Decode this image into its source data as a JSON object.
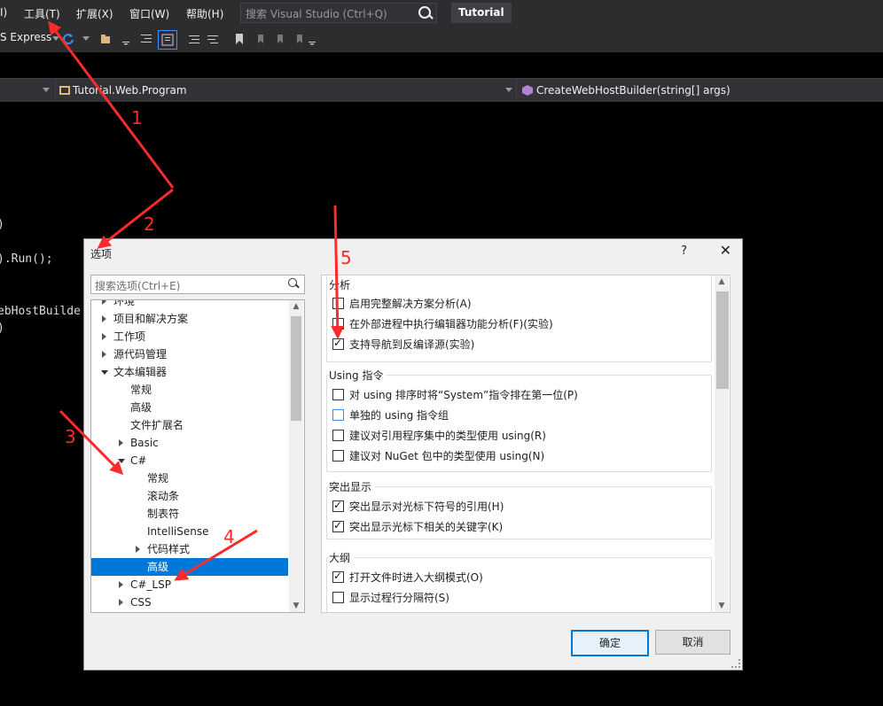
{
  "menu": {
    "items": [
      "I)",
      "工具(T)",
      "扩展(X)",
      "窗口(W)",
      "帮助(H)"
    ],
    "search_placeholder": "搜索 Visual Studio (Ctrl+Q)",
    "title": "Tutorial"
  },
  "toolbar": {
    "config_label": "S Express"
  },
  "navbar": {
    "class_label": "Tutorial.Web.Program",
    "member_label": "CreateWebHostBuilder(string[] args)"
  },
  "editor": {
    "lines": [
      ")",
      ").Run();",
      "ebHostBuilde",
      ")"
    ]
  },
  "dialog": {
    "title": "选项",
    "help": "?",
    "close": "✕",
    "search_placeholder": "搜索选项(Ctrl+E)",
    "tree": [
      "环境",
      "项目和解决方案",
      "工作项",
      "源代码管理",
      "文本编辑器",
      "常规",
      "高级",
      "文件扩展名",
      "Basic",
      "C#",
      "常规",
      "滚动条",
      "制表符",
      "IntelliSense",
      "代码样式",
      "高级",
      "C#_LSP",
      "CSS"
    ],
    "sections": [
      {
        "title": "分析",
        "options": [
          {
            "label": "启用完整解决方案分析(A)",
            "checked": false
          },
          {
            "label": "在外部进程中执行编辑器功能分析(F)(实验)",
            "checked": false
          },
          {
            "label": "支持导航到反编译源(实验)",
            "checked": true
          }
        ]
      },
      {
        "title": "Using 指令",
        "options": [
          {
            "label": "对 using 排序时将“System”指令排在第一位(P)",
            "checked": false
          },
          {
            "label": "单独的 using 指令组",
            "checked": false
          },
          {
            "label": "建议对引用程序集中的类型使用 using(R)",
            "checked": false
          },
          {
            "label": "建议对 NuGet 包中的类型使用 using(N)",
            "checked": false
          }
        ]
      },
      {
        "title": "突出显示",
        "options": [
          {
            "label": "突出显示对光标下符号的引用(H)",
            "checked": true
          },
          {
            "label": "突出显示光标下相关的关键字(K)",
            "checked": true
          }
        ]
      },
      {
        "title": "大纲",
        "options": [
          {
            "label": "打开文件时进入大纲模式(O)",
            "checked": true
          },
          {
            "label": "显示过程行分隔符(S)",
            "checked": false
          }
        ]
      }
    ],
    "ok": "确定",
    "cancel": "取消"
  },
  "annotations": [
    "1",
    "2",
    "3",
    "4",
    "5"
  ],
  "colors": {
    "annotation": "#ff2a2a",
    "selection": "#0078d7",
    "chrome": "#2d2d30"
  }
}
